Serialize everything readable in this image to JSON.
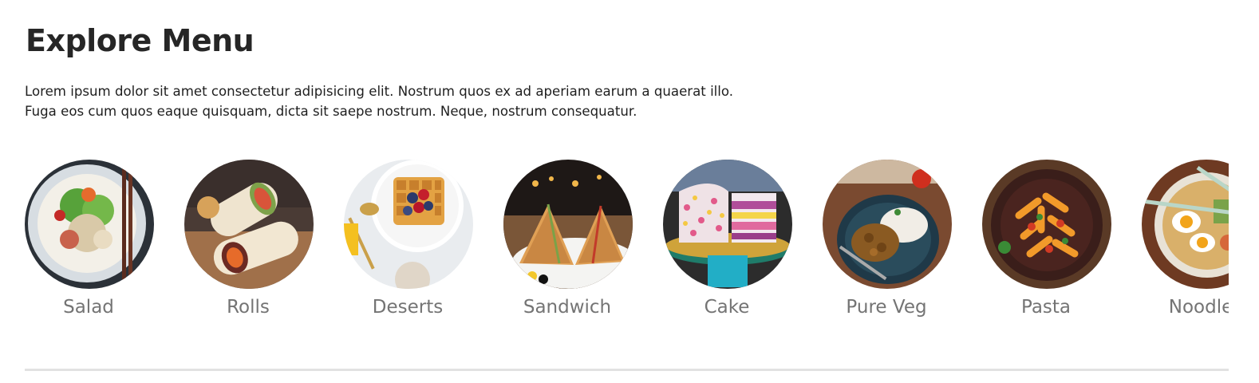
{
  "explore": {
    "title": "Explore Menu",
    "description": "Lorem ipsum dolor sit amet consectetur adipisicing elit. Nostrum quos ex ad aperiam earum a quaerat illo. Fuga eos cum quos eaque quisquam, dicta sit saepe nostrum. Neque, nostrum consequatur."
  },
  "menu": {
    "items": [
      {
        "label": "Salad"
      },
      {
        "label": "Rolls"
      },
      {
        "label": "Deserts"
      },
      {
        "label": "Sandwich"
      },
      {
        "label": "Cake"
      },
      {
        "label": "Pure Veg"
      },
      {
        "label": "Pasta"
      },
      {
        "label": "Noodles"
      }
    ]
  },
  "colors": {
    "heading": "#262626",
    "label": "#747474",
    "divider": "#e2e2e2"
  }
}
